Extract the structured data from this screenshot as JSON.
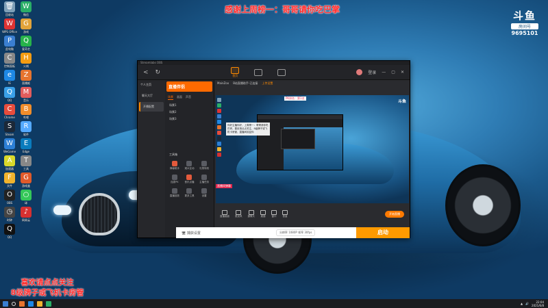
{
  "overlay": {
    "top_banner": "感谢上周榜一：哥哥请你吃巴掌",
    "bottom_note_line1": "喜欢请点点关注",
    "bottom_note_line2": "8级牌子或飞机卡房管"
  },
  "watermark": {
    "logo": "斗鱼",
    "room_label": "房间号",
    "room_id": "9695101"
  },
  "window": {
    "title": "Streamlabs OBS",
    "nav_back": "<",
    "nav_refresh": "↻",
    "home_label": "首页",
    "right_text": "登录"
  },
  "sidebar": {
    "header": "个人主页",
    "items": [
      {
        "label": "聊天大厅"
      },
      {
        "label": "开播配置"
      }
    ]
  },
  "panel": {
    "logo": "直播伴侣",
    "tabs": [
      "场景",
      "画面",
      "声音"
    ],
    "scenes": [
      "场景1",
      "场景2",
      "场景3"
    ],
    "tools_title": "工具箱",
    "tools": [
      "弹幕助手",
      "观众互动",
      "礼物特效",
      "连麦PK",
      "音乐点播",
      "主播任务",
      "直播回放",
      "更多工具",
      "设置"
    ]
  },
  "main": {
    "head_items": [
      "MainZoo",
      "B站直播助手-已连接",
      "上传设置"
    ],
    "preview_tag": "PK排名：第1名",
    "preview_text": "你好主播你好，上周榜一：哥哥请你吃巴掌。喜欢请点点关注，8级牌子或飞机卡房管，直播间欢迎你",
    "preview_tag2": "直播间弹幕",
    "preview_logo": "斗鱼",
    "controls": [
      "直播画面",
      "麦克风",
      "摄像头",
      "桌面",
      "窗口",
      "音量"
    ],
    "start_small": "开始直播"
  },
  "bottom_bar": {
    "left": "🖥 捕获设置",
    "mid": "分辨率 1080P 帧率 30fps",
    "start": "启动"
  },
  "taskbar": {
    "time": "22:04",
    "date": "2021/6/8"
  },
  "desktop_icons": [
    {
      "label": "回收站",
      "color": "#7fa0b8",
      "glyph": "🗑"
    },
    {
      "label": "微信",
      "color": "#2aae67",
      "glyph": "W"
    },
    {
      "label": "WPS Office",
      "color": "#d33",
      "glyph": "W"
    },
    {
      "label": "游戏",
      "color": "#e1a33a",
      "glyph": "G"
    },
    {
      "label": "此电脑",
      "color": "#3b7fd1",
      "glyph": "P"
    },
    {
      "label": "爱奇艺",
      "color": "#27b34a",
      "glyph": "Q"
    },
    {
      "label": "控制面板",
      "color": "#888",
      "glyph": "C"
    },
    {
      "label": "火绒",
      "color": "#f39c12",
      "glyph": "H"
    },
    {
      "label": "IE",
      "color": "#1e88e5",
      "glyph": "e"
    },
    {
      "label": "直播姬",
      "color": "#e6742f",
      "glyph": "Z"
    },
    {
      "label": "QQ",
      "color": "#3aa0e8",
      "glyph": "Q"
    },
    {
      "label": "音乐",
      "color": "#e25c5c",
      "glyph": "M"
    },
    {
      "label": "Chrome",
      "color": "#e74c3c",
      "glyph": "C"
    },
    {
      "label": "哔哩",
      "color": "#f08d2b",
      "glyph": "B"
    },
    {
      "label": "Steam",
      "color": "#1b2838",
      "glyph": "S"
    },
    {
      "label": "软件",
      "color": "#55aaff",
      "glyph": "R"
    },
    {
      "label": "WeGame",
      "color": "#2c7fd6",
      "glyph": "W"
    },
    {
      "label": "Edge",
      "color": "#0a7cbd",
      "glyph": "E"
    },
    {
      "label": "加速器",
      "color": "#d9d92b",
      "glyph": "A"
    },
    {
      "label": "工具",
      "color": "#888",
      "glyph": "T"
    },
    {
      "label": "文件",
      "color": "#f0b32e",
      "glyph": "F"
    },
    {
      "label": "游戏盒",
      "color": "#e05a2a",
      "glyph": "G"
    },
    {
      "label": "OBS",
      "color": "#222",
      "glyph": "O"
    },
    {
      "label": "球",
      "color": "#34c759",
      "glyph": "○"
    },
    {
      "label": "时钟",
      "color": "#444",
      "glyph": "◷"
    },
    {
      "label": "网易云",
      "color": "#d63031",
      "glyph": "♪"
    },
    {
      "label": "QQ",
      "color": "#111",
      "glyph": "Q"
    }
  ]
}
